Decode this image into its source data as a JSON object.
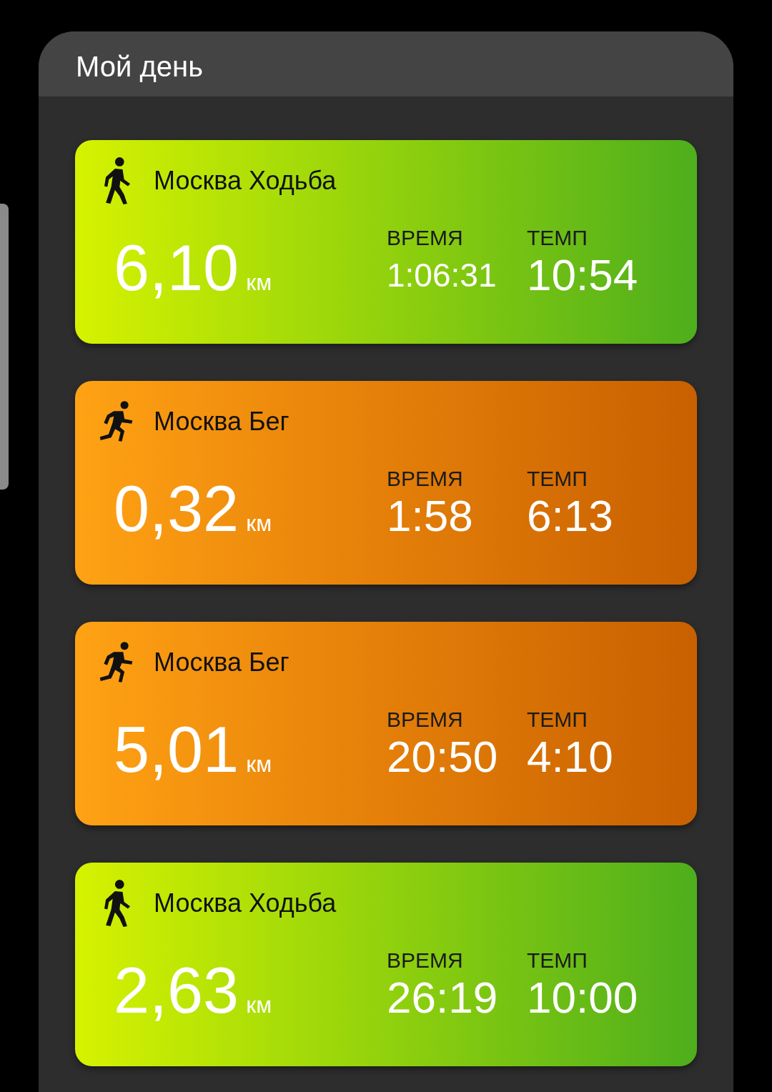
{
  "header": {
    "title": "Мой день"
  },
  "activities": [
    {
      "kind": "walk",
      "title": "Москва Ходьба",
      "distance": "6,10",
      "unit": "км",
      "time_label": "ВРЕМЯ",
      "time": "1:06:31",
      "pace_label": "ТЕМП",
      "pace": "10:54"
    },
    {
      "kind": "run",
      "title": "Москва Бег",
      "distance": "0,32",
      "unit": "км",
      "time_label": "ВРЕМЯ",
      "time": "1:58",
      "pace_label": "ТЕМП",
      "pace": "6:13"
    },
    {
      "kind": "run",
      "title": "Москва Бег",
      "distance": "5,01",
      "unit": "км",
      "time_label": "ВРЕМЯ",
      "time": "20:50",
      "pace_label": "ТЕМП",
      "pace": "4:10"
    },
    {
      "kind": "walk",
      "title": "Москва Ходьба",
      "distance": "2,63",
      "unit": "км",
      "time_label": "ВРЕМЯ",
      "time": "26:19",
      "pace_label": "ТЕМП",
      "pace": "10:00"
    }
  ]
}
